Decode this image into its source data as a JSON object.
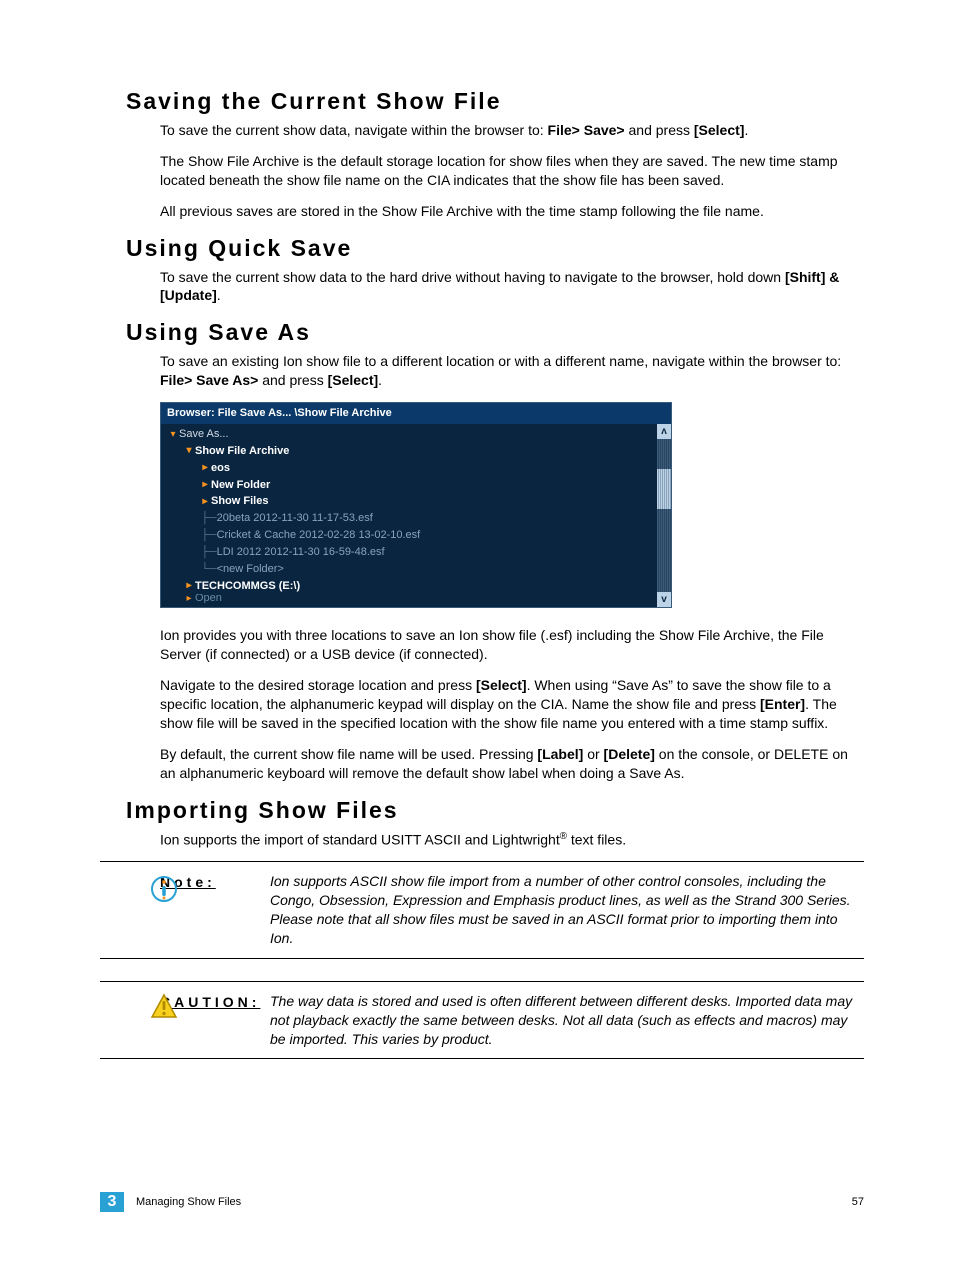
{
  "sections": {
    "saving": {
      "title": "Saving the Current Show File",
      "p1_pre": "To save the current show data, navigate within the browser to: ",
      "p1_bold1": "File> Save>",
      "p1_mid": " and press ",
      "p1_bold2": "[Select]",
      "p1_post": ".",
      "p2": "The Show File Archive is the default storage location for show files when they are saved. The new time stamp located beneath the show file name on the CIA indicates that the show file has been saved.",
      "p3": "All previous saves are stored in the Show File Archive with the time stamp following the file name."
    },
    "quicksave": {
      "title": "Using Quick Save",
      "p1_pre": "To save the current show data to the hard drive without having to navigate to the browser, hold down ",
      "p1_bold": "[Shift] & [Update]",
      "p1_post": "."
    },
    "saveas": {
      "title": "Using Save As",
      "p1_pre": "To save an existing Ion show file to a different location or with a different name, navigate within the browser to: ",
      "p1_bold1": "File> Save As>",
      "p1_mid": " and press ",
      "p1_bold2": "[Select]",
      "p1_post": ".",
      "p2": "Ion provides you with three locations to save an Ion show file (.esf) including the Show File Archive, the File Server (if connected) or a USB device (if connected).",
      "p3_pre": "Navigate to the desired storage location and press ",
      "p3_bold1": "[Select]",
      "p3_mid": ". When using “Save As” to save the show file to a specific location, the alphanumeric keypad will display on the CIA. Name the show file and press ",
      "p3_bold2": "[Enter]",
      "p3_post": ". The show file will be saved in the specified location with the show file name you entered with a time stamp suffix.",
      "p4_pre": "By default, the current show file name will be used. Pressing ",
      "p4_bold1": "[Label]",
      "p4_mid1": " or ",
      "p4_bold2": "[Delete]",
      "p4_post": " on the console, or DELETE on an alphanumeric keyboard will remove the default show label when doing a Save As."
    },
    "importing": {
      "title": "Importing Show Files",
      "p1_pre": "Ion supports the import of standard USITT ASCII and Lightwright",
      "p1_sup": "®",
      "p1_post": " text files."
    }
  },
  "browser": {
    "header": "Browser: File Save As... \\Show File Archive",
    "saveas": "Save As...",
    "archive": "Show File Archive",
    "eos": "eos",
    "newfolder": "New Folder",
    "showfiles": "Show Files",
    "file1": "20beta 2012-11-30 11-17-53.esf",
    "file2": "Cricket & Cache 2012-02-28 13-02-10.esf",
    "file3": "LDI 2012 2012-11-30 16-59-48.esf",
    "newfolder2": "<new Folder>",
    "techcommgs": "TECHCOMMGS (E:\\)",
    "open": "Open",
    "scroll_up": "ʌ",
    "scroll_down": "v"
  },
  "note": {
    "label": "Note:",
    "text": "Ion supports ASCII show file import from a number of other control consoles, including the Congo, Obsession, Expression and Emphasis product lines, as well as the Strand 300 Series. Please note that all show files must be saved in an ASCII format prior to importing them into Ion."
  },
  "caution": {
    "label": "CAUTION:",
    "text": "The way data is stored and used is often different between different desks. Imported data may not playback exactly the same between desks. Not all data (such as effects and macros) may be imported. This varies by product."
  },
  "footer": {
    "chapter": "3",
    "section": "Managing Show Files",
    "page": "57"
  }
}
